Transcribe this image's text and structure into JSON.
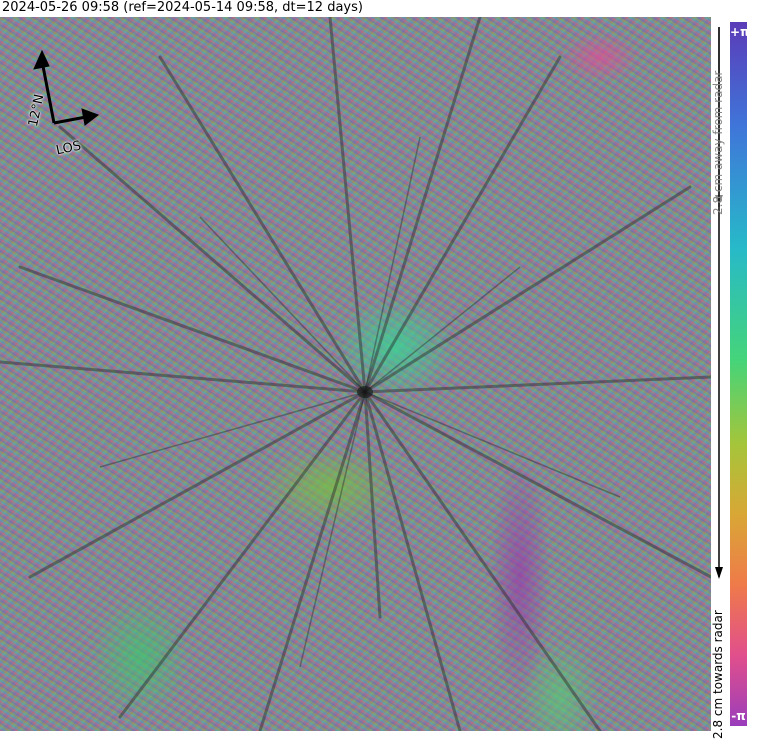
{
  "header": {
    "title": "2024-05-26 09:58 (ref=2024-05-14 09:58, dt=12 days)"
  },
  "orientation": {
    "north_label": "12°N",
    "los_label": "LOS"
  },
  "colorbar": {
    "top_label": "+π",
    "bottom_label": "-π",
    "away_label": "2.8 cm away from radar",
    "towards_label": "2.8 cm towards radar",
    "colors": [
      "#5b3bb8",
      "#3f76d9",
      "#27b9c9",
      "#45d47a",
      "#a5c53a",
      "#d9a735",
      "#ef7a4a",
      "#e14f8c",
      "#9a3dbb"
    ]
  }
}
